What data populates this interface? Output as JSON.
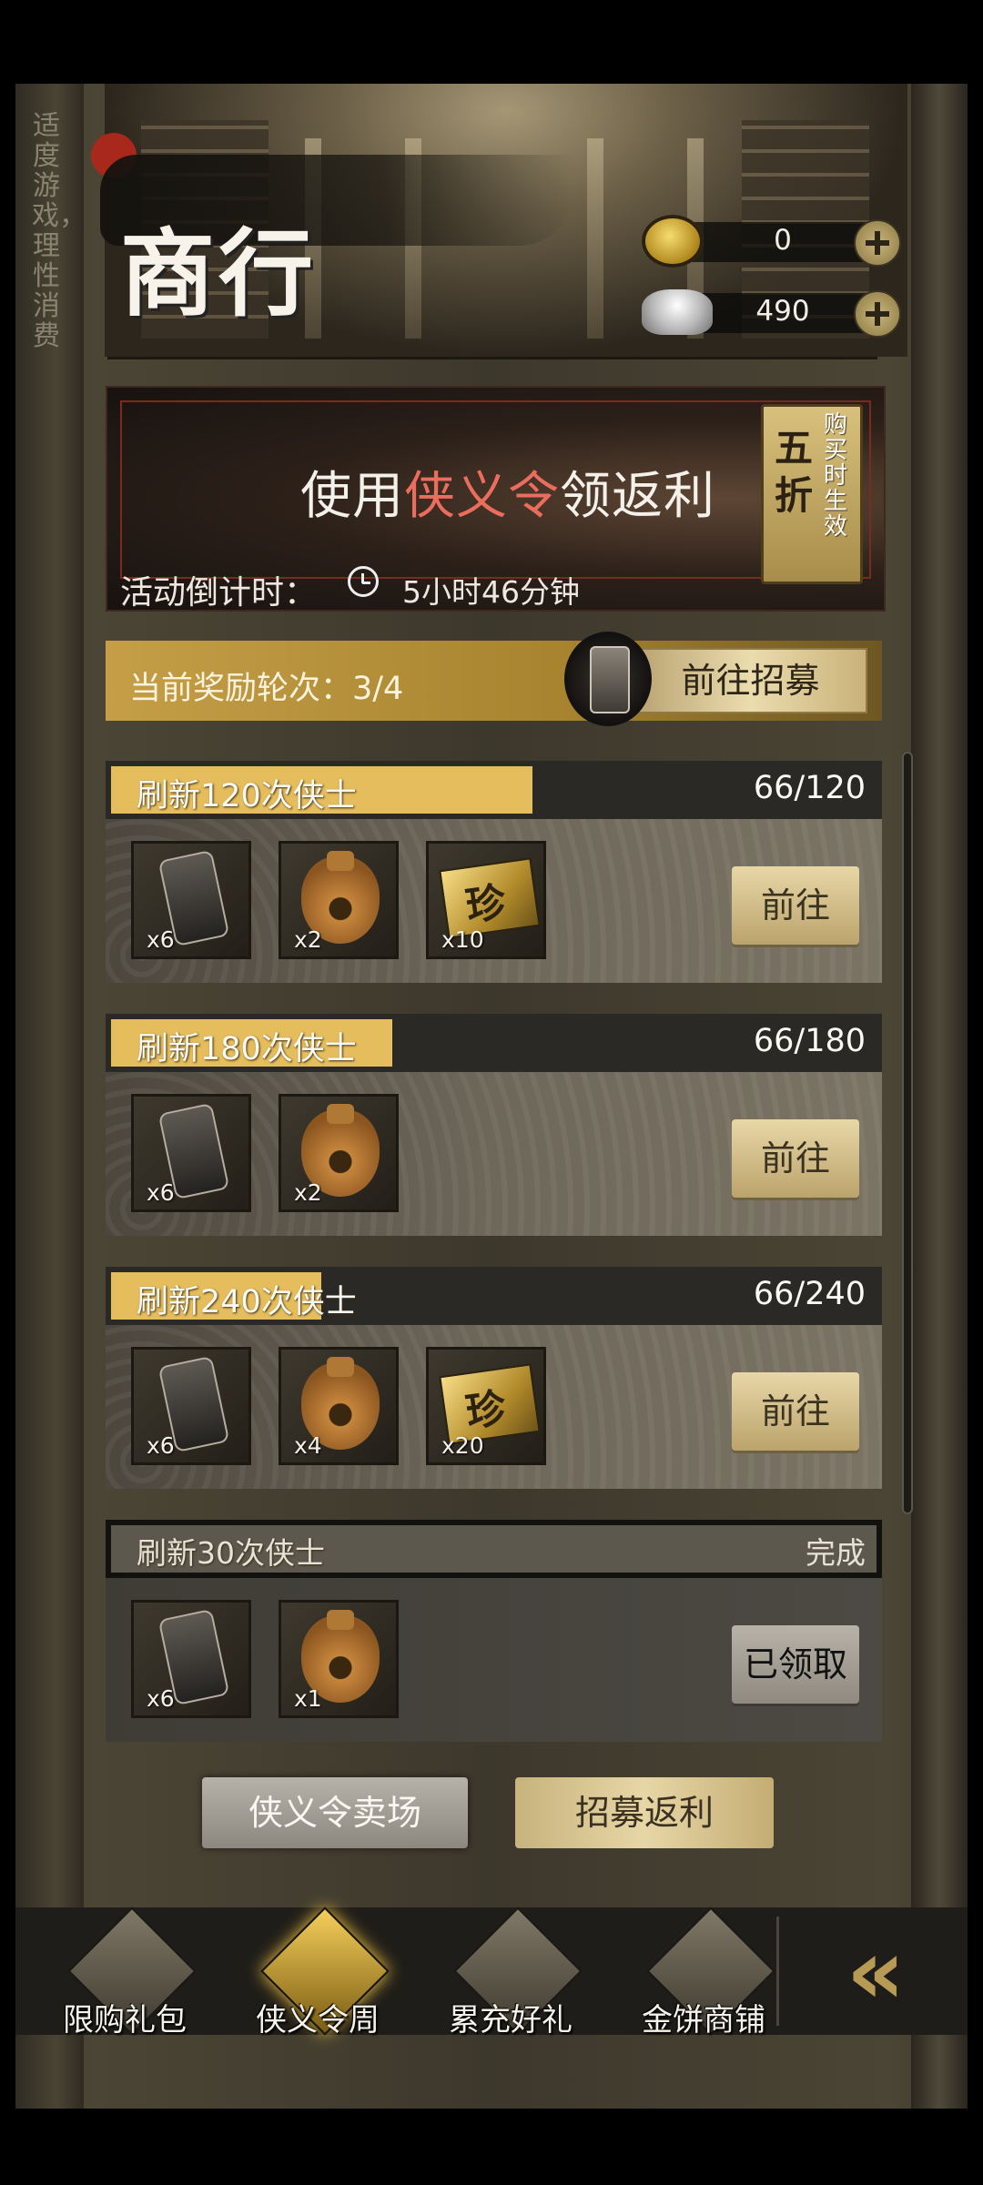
{
  "side_note": "适度游戏，理性消费",
  "header": {
    "title": "商行"
  },
  "currency": [
    {
      "icon": "gold-coin-icon",
      "value": "0"
    },
    {
      "icon": "silver-ingot-icon",
      "value": "490"
    }
  ],
  "banner": {
    "headline_pre": "使用",
    "headline_hl": "侠义令",
    "headline_post": "领返利",
    "discount_main": "五折",
    "discount_sub": "购买时生效",
    "countdown_label": "活动倒计时：",
    "countdown_value": "5小时46分钟"
  },
  "round": {
    "text": "当前奖励轮次：3/4",
    "recruit_label": "前往招募"
  },
  "tasks": [
    {
      "title": "刷新120次侠士",
      "count": "66/120",
      "progress": 0.55,
      "rewards": [
        {
          "type": "token",
          "qty": "x6"
        },
        {
          "type": "bag",
          "qty": "x2"
        },
        {
          "type": "treasure",
          "qty": "x10"
        }
      ],
      "action": "前往"
    },
    {
      "title": "刷新180次侠士",
      "count": "66/180",
      "progress": 0.367,
      "rewards": [
        {
          "type": "token",
          "qty": "x6"
        },
        {
          "type": "bag",
          "qty": "x2"
        }
      ],
      "action": "前往"
    },
    {
      "title": "刷新240次侠士",
      "count": "66/240",
      "progress": 0.275,
      "rewards": [
        {
          "type": "token",
          "qty": "x6"
        },
        {
          "type": "bag",
          "qty": "x4"
        },
        {
          "type": "treasure",
          "qty": "x20"
        }
      ],
      "action": "前往"
    },
    {
      "title": "刷新30次侠士",
      "count": "完成",
      "progress": 1.0,
      "rewards": [
        {
          "type": "token",
          "qty": "x6"
        },
        {
          "type": "bag",
          "qty": "x1"
        }
      ],
      "action": "已领取"
    }
  ],
  "buttons": {
    "shop": "侠义令卖场",
    "rebate": "招募返利"
  },
  "nav": [
    {
      "label": "限购礼包",
      "icon": "gift-pack-icon",
      "active": false
    },
    {
      "label": "侠义令周",
      "icon": "xia-token-icon",
      "active": true
    },
    {
      "label": "累充好礼",
      "icon": "silver-pile-icon",
      "active": false
    },
    {
      "label": "金饼商铺",
      "icon": "gold-cake-icon",
      "active": false
    }
  ],
  "colors": {
    "accent_gold": "#e6bd5c",
    "highlight_red": "#ea6d5e"
  }
}
